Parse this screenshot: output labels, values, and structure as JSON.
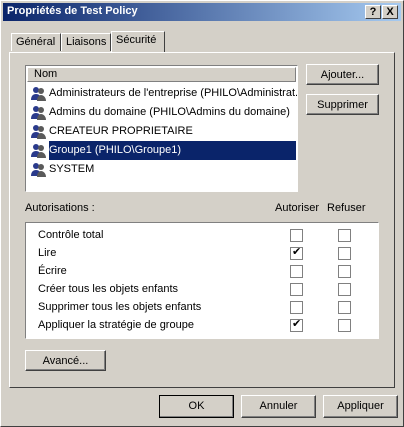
{
  "window": {
    "title": "Propriétés de Test Policy",
    "help_glyph": "?",
    "close_glyph": "X"
  },
  "tabs": [
    {
      "label": "Général"
    },
    {
      "label": "Liaisons"
    },
    {
      "label": "Sécurité"
    }
  ],
  "active_tab": "Sécurité",
  "principals": {
    "column_header": "Nom",
    "items": [
      {
        "label": "Administrateurs de l'entreprise (PHILO\\Administrat...",
        "selected": false
      },
      {
        "label": "Admins du domaine (PHILO\\Admins du domaine)",
        "selected": false
      },
      {
        "label": "CREATEUR PROPRIETAIRE",
        "selected": false
      },
      {
        "label": "Groupe1 (PHILO\\Groupe1)",
        "selected": true
      },
      {
        "label": "SYSTEM",
        "selected": false
      }
    ]
  },
  "buttons": {
    "add": "Ajouter...",
    "remove": "Supprimer",
    "advanced": "Avancé...",
    "ok": "OK",
    "cancel": "Annuler",
    "apply": "Appliquer"
  },
  "permissions": {
    "label": "Autorisations :",
    "allow_header": "Autoriser",
    "deny_header": "Refuser",
    "rows": [
      {
        "label": "Contrôle total",
        "allow": false,
        "deny": false
      },
      {
        "label": "Lire",
        "allow": true,
        "deny": false
      },
      {
        "label": "Écrire",
        "allow": false,
        "deny": false
      },
      {
        "label": "Créer tous les objets enfants",
        "allow": false,
        "deny": false
      },
      {
        "label": "Supprimer tous les objets enfants",
        "allow": false,
        "deny": false
      },
      {
        "label": "Appliquer la stratégie de groupe",
        "allow": true,
        "deny": false
      }
    ]
  },
  "icons": {
    "principal": "group-users-icon"
  },
  "colors": {
    "title_start": "#0a246a",
    "title_end": "#a6caf0",
    "selection": "#0a246a",
    "face": "#d4d0c8"
  }
}
